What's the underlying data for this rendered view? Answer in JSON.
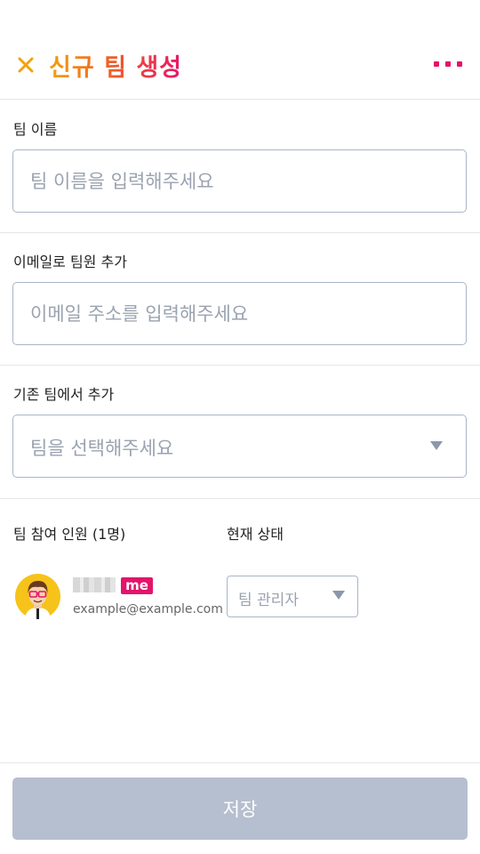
{
  "header": {
    "title": "신규 팀 생성",
    "close_icon": "close-icon",
    "more_icon": "more-dots-icon",
    "accent_colors": [
      "#f0a20e",
      "#ef5a2a",
      "#e8156b"
    ]
  },
  "team_name": {
    "label": "팀 이름",
    "value": "",
    "placeholder": "팀 이름을 입력해주세요"
  },
  "email_add": {
    "label": "이메일로 팀원 추가",
    "value": "",
    "placeholder": "이메일 주소를 입력해주세요"
  },
  "existing_team": {
    "label": "기존 팀에서 추가",
    "selected": "팀을 선택해주세요"
  },
  "members": {
    "count_label": "팀 참여 인원 (1명)",
    "status_label": "현재 상태",
    "list": [
      {
        "badge": "me",
        "email": "example@example.com",
        "role": "팀 관리자"
      }
    ]
  },
  "footer": {
    "save_label": "저장"
  }
}
